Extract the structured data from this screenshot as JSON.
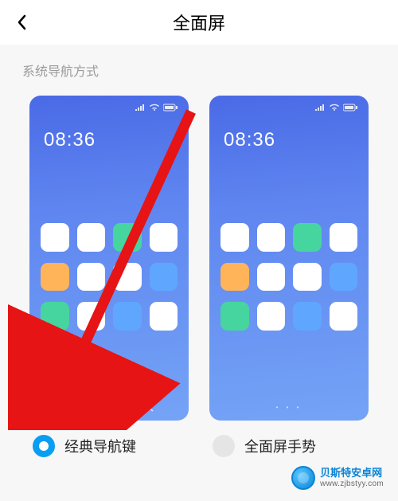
{
  "header": {
    "title": "全面屏"
  },
  "subtitle": "系统导航方式",
  "options": [
    {
      "key": "classic",
      "label": "经典导航键",
      "selected": true,
      "clock": "08:36",
      "shows_navbar": true,
      "icon_colors": [
        "w",
        "w",
        "g",
        "w",
        "o",
        "w",
        "w",
        "b",
        "g",
        "w",
        "b",
        "w"
      ]
    },
    {
      "key": "gesture",
      "label": "全面屏手势",
      "selected": false,
      "clock": "08:36",
      "shows_navbar": false,
      "icon_colors": [
        "w",
        "w",
        "g",
        "w",
        "o",
        "w",
        "w",
        "b",
        "g",
        "w",
        "b",
        "w"
      ]
    }
  ],
  "color_map": {
    "w": "#ffffff",
    "g": "#46d59f",
    "o": "#ffb459",
    "b": "#5fa6ff"
  },
  "arrow_color": "#e61414",
  "watermark": {
    "line1": "贝斯特安卓网",
    "line2": "www.zjbstyy.com"
  }
}
